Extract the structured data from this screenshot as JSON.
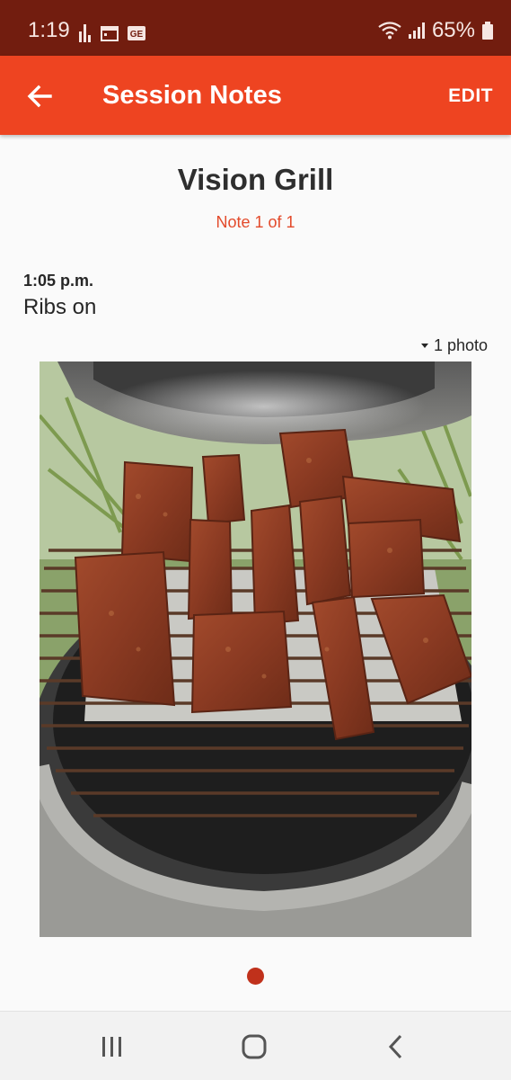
{
  "status_bar": {
    "time": "1:19",
    "battery": "65%",
    "icons": [
      "bar-chart-icon",
      "calendar-icon",
      "ge-icon",
      "wifi-icon",
      "signal-icon",
      "battery-icon"
    ]
  },
  "app_bar": {
    "title": "Session Notes",
    "edit_label": "EDIT",
    "back_icon": "arrow-back-icon",
    "color": "#ee4421"
  },
  "session": {
    "title": "Vision Grill",
    "note_counter": "Note 1 of 1"
  },
  "note": {
    "time": "1:05 p.m.",
    "text": "Ribs on",
    "photo_toggle": "1 photo",
    "photo_subject": "ribs on grill grate"
  },
  "pager": {
    "active_dot_color": "#c0311b"
  },
  "nav_bar": {
    "icons": [
      "recent-apps-icon",
      "home-icon",
      "back-icon"
    ]
  }
}
